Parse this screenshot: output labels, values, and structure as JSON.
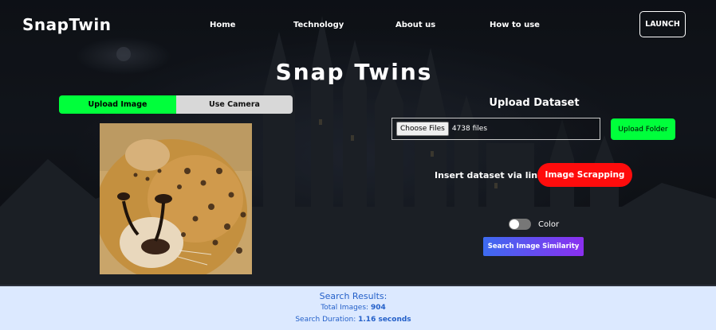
{
  "header": {
    "logo": "SnapTwin",
    "nav": [
      "Home",
      "Technology",
      "About us",
      "How to use"
    ],
    "launch_label": "LAUNCH"
  },
  "main": {
    "title": "Snap Twins",
    "tabs": [
      {
        "label": "Upload Image",
        "active": true
      },
      {
        "label": "Use Camera",
        "active": false
      }
    ],
    "image_subject": "cheetah"
  },
  "dataset": {
    "title": "Upload Dataset",
    "choose_files_label": "Choose Files",
    "file_count": "4738 files",
    "upload_folder_label": "Upload Folder",
    "link_label": "Insert dataset via link :",
    "scrapping_label": "Image Scrapping",
    "color_toggle_label": "Color",
    "color_toggle_on": false,
    "search_label": "Search Image Similarity"
  },
  "results": {
    "title": "Search Results:",
    "total_label": "Total Images:",
    "total_value": "904",
    "duration_label": "Search Duration:",
    "duration_value": "1.16 seconds"
  },
  "colors": {
    "accent_green": "#00ff3b",
    "accent_red": "#ff0c0c",
    "gradient_start": "#3d6bf0",
    "gradient_end": "#8b2ff0",
    "results_bg": "#dce9ff",
    "results_text": "#2460c9"
  }
}
